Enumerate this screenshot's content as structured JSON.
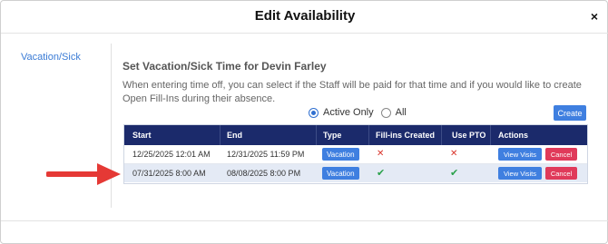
{
  "dialog": {
    "title": "Edit Availability",
    "close_symbol": "×"
  },
  "sidebar": {
    "items": [
      {
        "label": "Vacation/Sick"
      }
    ]
  },
  "section": {
    "title": "Set Vacation/Sick Time for Devin Farley",
    "description": "When entering time off, you can select if the Staff will be paid for that time and if you would like to create Open Fill-Ins during their absence."
  },
  "filter": {
    "options": [
      "Active Only",
      "All"
    ],
    "selected": "Active Only"
  },
  "create_label": "Create",
  "table": {
    "columns": [
      "Start",
      "End",
      "Type",
      "Fill-ins Created",
      "Use PTO",
      "Actions"
    ],
    "rows": [
      {
        "start": "12/25/2025 12:01 AM",
        "end": "12/31/2025 11:59 PM",
        "type": "Vacation",
        "fill_ins_created": "no",
        "use_pto": "no",
        "view_label": "View Visits",
        "cancel_label": "Cancel"
      },
      {
        "start": "07/31/2025 8:00 AM",
        "end": "08/08/2025 8:00 PM",
        "type": "Vacation",
        "fill_ins_created": "yes",
        "use_pto": "yes",
        "view_label": "View Visits",
        "cancel_label": "Cancel"
      }
    ]
  },
  "icons": {
    "cross": "✕",
    "check": "✔"
  },
  "colors": {
    "header_bg": "#1b2a6b",
    "primary": "#3f7fe0",
    "danger": "#e03a5a",
    "annotation_arrow": "#e53935",
    "selected_row": "#e4eaf5"
  }
}
